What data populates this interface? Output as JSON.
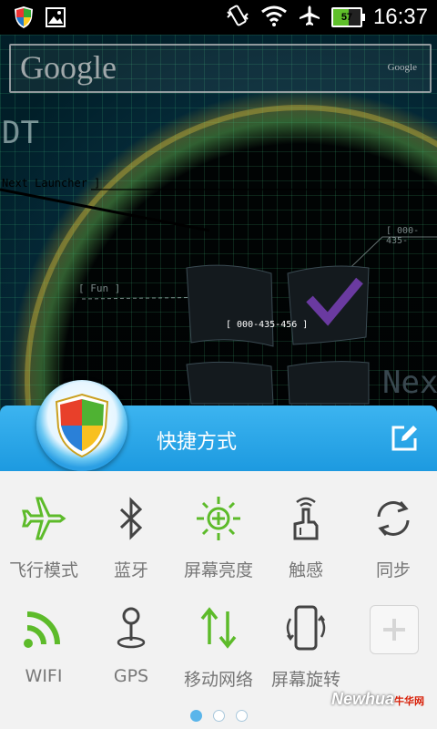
{
  "status_bar": {
    "time": "16:37",
    "battery_level": "57",
    "icons": [
      "security-shield-icon",
      "gallery-icon",
      "vibrate-icon",
      "wifi-icon",
      "airplane-icon",
      "battery-icon"
    ]
  },
  "wallpaper": {
    "google_logo": "Google",
    "google_small": "Google",
    "text_dt": "DT",
    "text_launcher": "Next Launcher ]",
    "text_fun": "[ Fun ]",
    "text_code1": "[ 000-435-456 ]",
    "text_code2": "[ 000-435-",
    "text_next": "Next"
  },
  "panel": {
    "title": "快捷方式",
    "header_color": "#1d9ae0",
    "accent_green": "#5dbb2a",
    "tiles": [
      {
        "label": "飞行模式",
        "icon": "airplane-icon"
      },
      {
        "label": "蓝牙",
        "icon": "bluetooth-icon"
      },
      {
        "label": "屏幕亮度",
        "icon": "brightness-icon"
      },
      {
        "label": "触感",
        "icon": "haptic-touch-icon"
      },
      {
        "label": "同步",
        "icon": "sync-icon"
      },
      {
        "label": "WIFI",
        "icon": "wifi-icon"
      },
      {
        "label": "GPS",
        "icon": "gps-pin-icon"
      },
      {
        "label": "移动网络",
        "icon": "mobile-data-icon"
      },
      {
        "label": "屏幕旋转",
        "icon": "screen-rotate-icon"
      }
    ],
    "add_icon": "plus-icon",
    "pages": 3,
    "active_page": 1
  },
  "watermark": {
    "brand": "Newhua",
    "domain": ".com",
    "cn": "牛华网"
  }
}
